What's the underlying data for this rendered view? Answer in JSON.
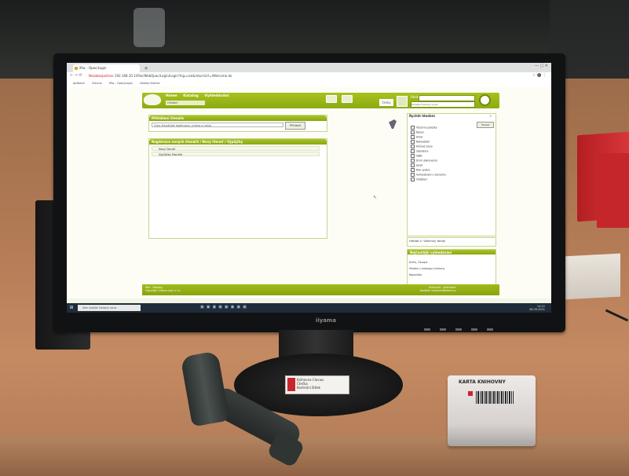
{
  "monitor": {
    "brand": "iiyama"
  },
  "browser": {
    "tab_title": "iPac - Opac/Login",
    "new_tab": "+",
    "window_controls": "—  ▢  ✕",
    "nav": "←  →  ⟳",
    "url_warning": "Nezabezpečeno",
    "url": "192.168.10.1/iPac/WebOpac/Login/Login?lng=cze&returnUrl=/Welcome.do",
    "extensions": "☆  ⬤  ⋮",
    "bookmarks": [
      "Aplikace",
      "Clavius",
      "iPac - Opac/Login",
      "Ukázky Klavíra"
    ]
  },
  "site": {
    "nav_items": [
      "Home",
      "Katalog",
      "Vyhledávání"
    ],
    "subnav": "Hledání",
    "lang_box": "česky",
    "search_label": "Hledat:",
    "search_placeholder": "Zadejte hledaný výraz",
    "panel1_title": "Přihlášení čtenáře",
    "panel1_input": "Číslo čtenářské legitimace, jméno a heslo",
    "panel1_button": "Přihlásit",
    "panel2_title": "Registrace nových čtenářů / Nový čtenář / Výpůjčky",
    "panel2_rows": [
      "Nový čtenář",
      "Výpůjčky čtenáře"
    ],
    "side_title": "Rychlé hledání",
    "side_close": "×",
    "side_button": "Hledat",
    "side_items": [
      "Všechny položky",
      "Název",
      "Autor",
      "Nakladatel",
      "Klíčové slovo",
      "Signatura",
      "ISBN",
      "Druh dokumentu",
      "Jazyk",
      "Rok vydání",
      "Vyhledávání v záznamu",
      "Oddělení"
    ],
    "side2_title": "Hledat v: Všechny fondy",
    "side3_title": "Nejčastější vyhledávání",
    "side3_lines": [
      "Kniha, Časopis",
      "Hledání v katalogu knihovny",
      "Nápověda"
    ],
    "side3_link": "Zobrazit",
    "footer_left": [
      "iPac - Katalog",
      "Copyright Clavius spol. s r.o."
    ],
    "footer_right": [
      "Knihovna - informace",
      "Kontakt: knihovna@email.cz"
    ]
  },
  "taskbar": {
    "start_icon": "⊞",
    "search_text": "Sem zadejte hledaný výraz",
    "tray": [
      "14:22",
      "28.09.2021"
    ]
  },
  "scene": {
    "card_stack_title": "KARTA KNIHOVNY",
    "base_label_lines": [
      "Knihovna Clavius",
      "Čtečka",
      "Kontrolní štítek"
    ]
  },
  "colors": {
    "site_green": "#9ab819",
    "screen_bg": "#f3f5e6",
    "taskbar": "#1f2d3a",
    "desk": "#b27b55"
  }
}
